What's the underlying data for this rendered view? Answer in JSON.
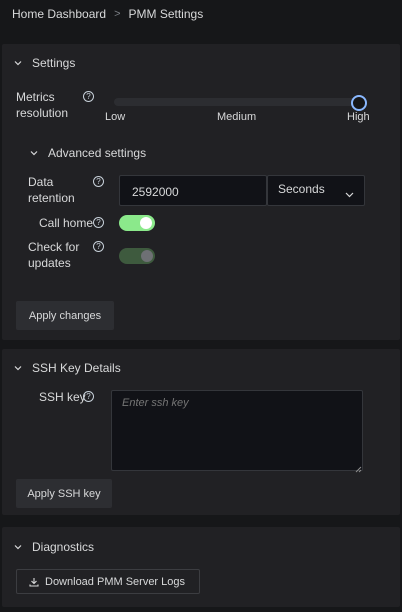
{
  "breadcrumb": {
    "home": "Home Dashboard",
    "separator": ">",
    "current": "PMM Settings"
  },
  "settings": {
    "title": "Settings",
    "metrics_resolution": {
      "label": "Metrics resolution",
      "ticks": [
        "Low",
        "Medium",
        "High"
      ],
      "selected": "High"
    },
    "advanced": {
      "title": "Advanced settings",
      "data_retention": {
        "label": "Data retention",
        "value": "2592000",
        "unit": "Seconds"
      },
      "call_home": {
        "label": "Call home",
        "enabled": true
      },
      "check_updates": {
        "label": "Check for updates",
        "enabled": false
      }
    },
    "apply_label": "Apply changes"
  },
  "ssh": {
    "title": "SSH Key Details",
    "label": "SSH key",
    "placeholder": "Enter ssh key",
    "apply_label": "Apply SSH key"
  },
  "diagnostics": {
    "title": "Diagnostics",
    "download_label": "Download PMM Server Logs"
  },
  "colors": {
    "toggle_on": "#8be98b",
    "toggle_off": "#3e5a3e",
    "thumb_border": "#8ab8ff"
  }
}
